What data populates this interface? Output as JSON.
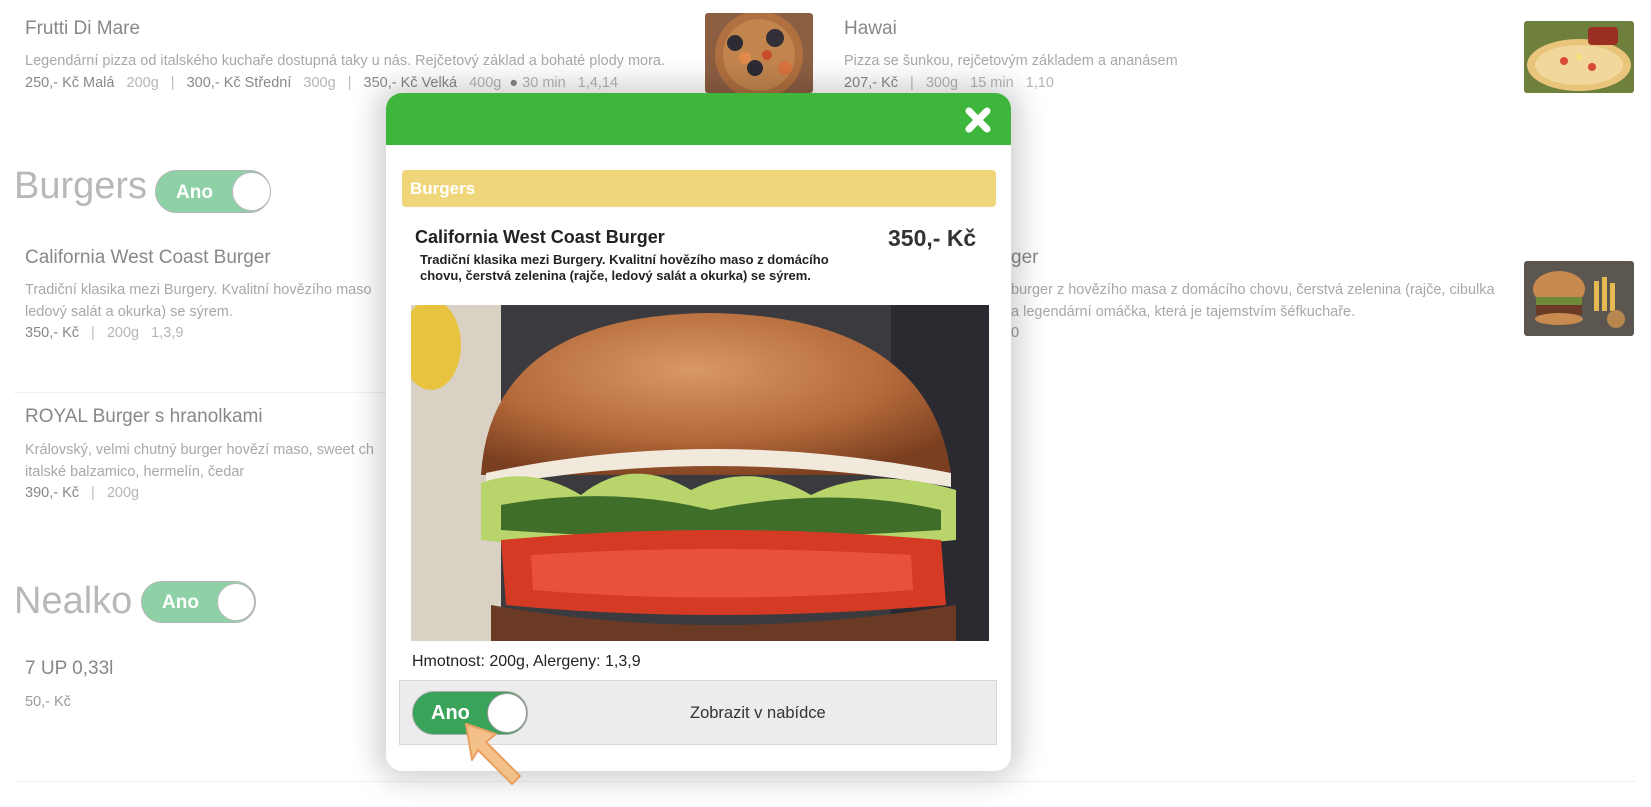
{
  "menu": {
    "frutti": {
      "title": "Frutti Di Mare",
      "desc": "Legendární pizza od italského kuchaře dostupná taky u nás. Rejčetový základ a bohaté plody mora.",
      "price1": "250,- Kč Malá",
      "w1": "200g",
      "price2": "300,- Kč Střední",
      "w2": "300g",
      "price3": "350,- Kč Velká",
      "w3": "400g",
      "time": "30 min",
      "allergens": "1,4,14"
    },
    "hawai": {
      "title": "Hawai",
      "desc": "Pizza se šunkou, rejčetovým základem a ananásem",
      "price": "207,- Kč",
      "weight": "300g",
      "time": "15 min",
      "allergens": "1,10"
    },
    "burgers": {
      "heading": "Burgers",
      "toggle_label": "Ano",
      "california": {
        "title": "California West Coast Burger",
        "desc": "Tradiční klasika mezi Burgery. Kvalitní hovězího maso",
        "desc2": "ledový salát a okurka) se sýrem.",
        "price": "350,- Kč",
        "weight": "200g",
        "allergens": "1,3,9"
      },
      "royal": {
        "title": "ROYAL Burger s hranolkami",
        "desc": "Královský, velmi chutný burger hovězí maso, sweet ch",
        "desc2": "italské balzamico, hermelín, čedar",
        "price": "390,- Kč",
        "weight": "200g"
      },
      "right_item": {
        "title_fragment": "ger",
        "desc": "burger z hovězího masa z domácího chovu, čerstvá zelenina (rajče, cibulka",
        "desc2": "a legendární omáčka, která je tajemstvím šéfkuchaře.",
        "meta_fragment": "0"
      }
    },
    "nealko": {
      "heading": "Nealko",
      "toggle_label": "Ano",
      "sevenup": {
        "title": "7 UP 0,33l",
        "price": "50,- Kč"
      }
    }
  },
  "modal": {
    "category": "Burgers",
    "title": "California West Coast Burger",
    "price": "350,- Kč",
    "desc": "Tradiční klasika mezi Burgery. Kvalitní hovězího maso z domácího chovu, čerstvá zelenina (rajče, ledový salát a okurka) se sýrem.",
    "info": "Hmotnost: 200g, Alergeny: 1,3,9",
    "toggle_label": "Ano",
    "show_label": "Zobrazit v nabídce"
  },
  "colors": {
    "header_green": "#3db63b",
    "category_yellow": "#efd67b",
    "toggle_green": "#3aa35a",
    "toggle_light_green": "#8fd1a7"
  },
  "icons": [
    "close-icon",
    "edit-icon",
    "expand-icon",
    "cursor-arrow-icon"
  ]
}
